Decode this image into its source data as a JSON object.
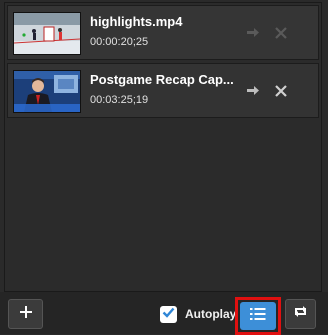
{
  "playlist": {
    "items": [
      {
        "title": "highlights.mp4",
        "duration": "00:00:20;25"
      },
      {
        "title": "Postgame Recap Cap...",
        "duration": "00:03:25;19"
      }
    ]
  },
  "footer": {
    "autoplay_label": "Autoplay",
    "autoplay_checked": true
  },
  "colors": {
    "accent": "#3d8fd8",
    "highlight_border": "#e01010"
  },
  "icons": {
    "add": "plus-icon",
    "list": "list-icon",
    "loop": "repeat-icon",
    "share": "share-arrow-icon",
    "remove": "close-icon",
    "check": "checkmark-icon"
  }
}
